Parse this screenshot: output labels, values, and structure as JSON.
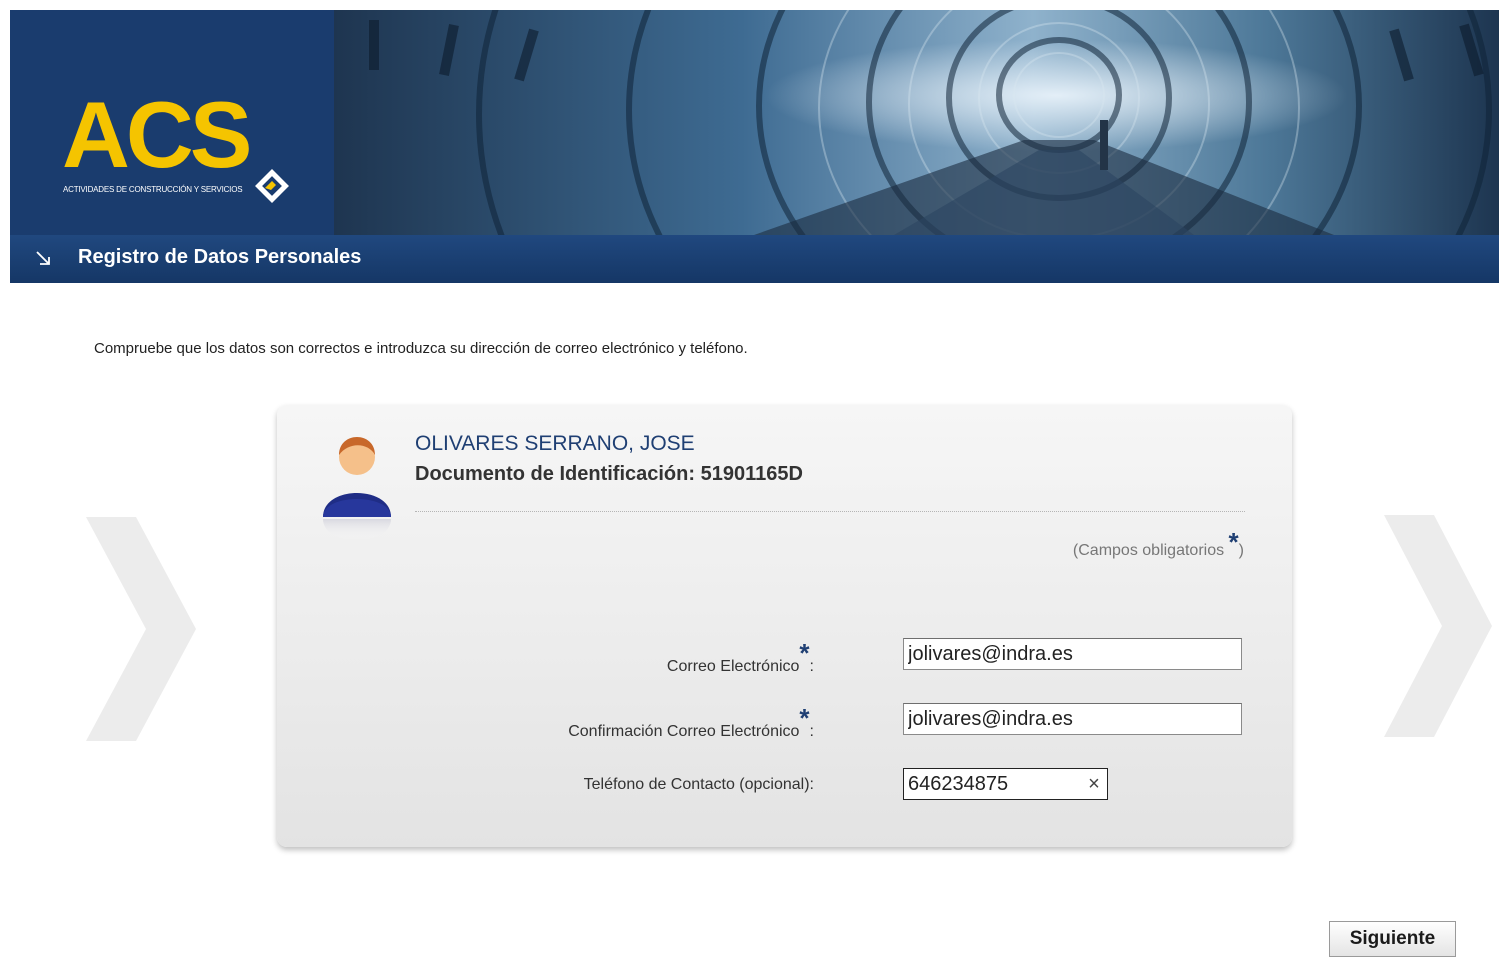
{
  "header": {
    "logo_text": "ACS",
    "logo_subtitle": "ACTIVIDADES DE CONSTRUCCIÓN Y SERVICIOS",
    "page_title": "Registro de Datos Personales"
  },
  "intro": "Compruebe que los datos son correctos e introduzca su dirección de correo electrónico y teléfono.",
  "user": {
    "name": "OLIVARES SERRANO, JOSE",
    "document_line": "Documento de Identificación: 51901165D"
  },
  "required_note": {
    "prefix": "(Campos obligatorios ",
    "star": "*",
    "suffix": ")"
  },
  "form": {
    "email_label": "Correo Electrónico",
    "email_value": "jolivares@indra.es",
    "email_confirm_label": "Confirmación Correo Electrónico",
    "email_confirm_value": "jolivares@indra.es",
    "phone_label": "Teléfono de Contacto (opcional):",
    "phone_value": "646234875",
    "clear_glyph": "×",
    "label_colon": ":",
    "star": "*"
  },
  "buttons": {
    "next": "Siguiente"
  },
  "colors": {
    "brand_navy": "#1a3c6e",
    "logo_yellow": "#f5c400",
    "title_blue": "#1f3f73"
  },
  "icons": {
    "title_arrow": "arrow-down-right-icon",
    "avatar": "user-avatar-icon",
    "left_nav": "chevron-right-icon",
    "right_nav": "chevron-right-icon"
  }
}
